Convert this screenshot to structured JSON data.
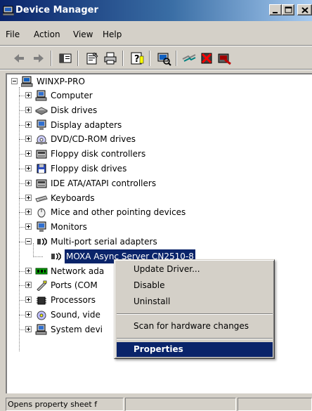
{
  "window": {
    "title": "Device Manager"
  },
  "menubar": {
    "items": [
      "File",
      "Action",
      "View",
      "Help"
    ]
  },
  "toolbar": {
    "buttons": [
      "back-arrow-icon",
      "forward-arrow-icon",
      "show-hide-console-tree-icon",
      "properties-icon",
      "print-icon",
      "help-icon",
      "scan-hardware-icon",
      "update-driver-icon",
      "uninstall-icon",
      "disable-icon"
    ]
  },
  "tree": {
    "root": "WINXP-PRO",
    "categories": [
      "Computer",
      "Disk drives",
      "Display adapters",
      "DVD/CD-ROM drives",
      "Floppy disk controllers",
      "Floppy disk drives",
      "IDE ATA/ATAPI controllers",
      "Keyboards",
      "Mice and other pointing devices",
      "Monitors",
      "Multi-port serial adapters",
      "MOXA Async Server CN2510-8",
      "Network ada",
      "Ports (COM",
      "Processors",
      "Sound, vide",
      "System devi"
    ],
    "selected": "MOXA Async Server CN2510-8"
  },
  "context_menu": {
    "items": [
      "Update Driver...",
      "Disable",
      "Uninstall",
      "Scan for hardware changes",
      "Properties"
    ],
    "highlighted": "Properties"
  },
  "statusbar": {
    "text": "Opens property sheet f"
  },
  "colors": {
    "selection": "#0a246a",
    "title_gradient_start": "#0a246a",
    "face": "#d4d0c8"
  }
}
